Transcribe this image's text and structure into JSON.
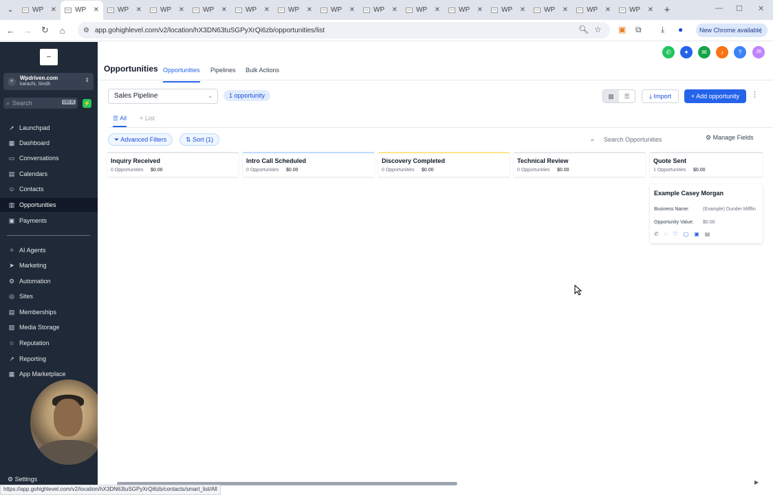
{
  "browser": {
    "tabs": [
      {
        "label": "WP"
      },
      {
        "label": "WP"
      },
      {
        "label": "WP"
      },
      {
        "label": "WP"
      },
      {
        "label": "WP"
      },
      {
        "label": "WP"
      },
      {
        "label": "WP"
      },
      {
        "label": "WP"
      },
      {
        "label": "WP"
      },
      {
        "label": "WP"
      },
      {
        "label": "WP"
      },
      {
        "label": "WP"
      },
      {
        "label": "WP"
      },
      {
        "label": "WP"
      },
      {
        "label": "WP"
      }
    ],
    "active_tab_index": 1,
    "url": "app.gohighlevel.com/v2/location/hX3DN63tuSGPyXrQi6zb/opportunities/list",
    "new_chrome_label": "New Chrome available",
    "status_url": "https://app.gohighlevel.com/v2/location/hX3DN63tuSGPyXrQi6zb/contacts/smart_list/All"
  },
  "sidebar": {
    "account_name": "Wpdriven.com",
    "account_location": "karachi, Sindh",
    "search_placeholder": "Search",
    "search_shortcut": "ctrl K",
    "items": [
      {
        "label": "Launchpad",
        "icon": "launchpad-icon"
      },
      {
        "label": "Dashboard",
        "icon": "dashboard-icon"
      },
      {
        "label": "Conversations",
        "icon": "conversations-icon"
      },
      {
        "label": "Calendars",
        "icon": "calendar-icon"
      },
      {
        "label": "Contacts",
        "icon": "contacts-icon"
      },
      {
        "label": "Opportunities",
        "icon": "opportunities-icon",
        "active": true
      },
      {
        "label": "Payments",
        "icon": "payments-icon"
      }
    ],
    "items2": [
      {
        "label": "AI Agents",
        "icon": "ai-agents-icon"
      },
      {
        "label": "Marketing",
        "icon": "marketing-icon"
      },
      {
        "label": "Automation",
        "icon": "automation-icon"
      },
      {
        "label": "Sites",
        "icon": "sites-icon"
      },
      {
        "label": "Memberships",
        "icon": "memberships-icon"
      },
      {
        "label": "Media Storage",
        "icon": "media-storage-icon"
      },
      {
        "label": "Reputation",
        "icon": "reputation-icon"
      },
      {
        "label": "Reporting",
        "icon": "reporting-icon"
      },
      {
        "label": "App Marketplace",
        "icon": "app-marketplace-icon"
      }
    ],
    "settings_label": "Settings"
  },
  "header": {
    "title": "Opportunities",
    "tabs": [
      {
        "label": "Opportunities",
        "active": true
      },
      {
        "label": "Pipelines"
      },
      {
        "label": "Bulk Actions"
      }
    ],
    "user_initials": "JB"
  },
  "toolbar": {
    "pipeline_value": "Sales Pipeline",
    "opportunity_count": "1 opportunity",
    "import_label": "Import",
    "add_label": "Add opportunity",
    "subtabs": [
      {
        "label": "All",
        "active": true
      },
      {
        "label": "List"
      }
    ],
    "advanced_filters_label": "Advanced Filters",
    "sort_label": "Sort (1)",
    "search_placeholder": "Search Opportunities",
    "manage_fields_label": "Manage Fields"
  },
  "stages": [
    {
      "name": "Inquiry Received",
      "count": "0 Opportunities",
      "amount": "$0.00"
    },
    {
      "name": "Intro Call Scheduled",
      "count": "0 Opportunities",
      "amount": "$0.00"
    },
    {
      "name": "Discovery Completed",
      "count": "0 Opportunities",
      "amount": "$0.00"
    },
    {
      "name": "Technical Review",
      "count": "0 Opportunities",
      "amount": "$0.00"
    },
    {
      "name": "Quote Sent",
      "count": "1 Opportunities",
      "amount": "$0.00"
    }
  ],
  "card": {
    "name": "Example Casey Morgan",
    "business_label": "Business Name:",
    "business_value": "(Example) Dunder Mifflin",
    "value_label": "Opportunity Value:",
    "value_value": "$0.00"
  }
}
